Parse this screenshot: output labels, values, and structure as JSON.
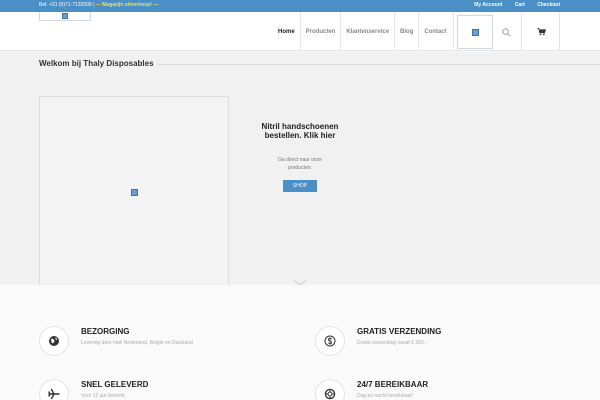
{
  "topbar": {
    "phone": "Bel: +31 (0)71-7132099",
    "promo": "| — Magazijn uitverkoop! —",
    "links": [
      "My Account",
      "Cart",
      "Checkout"
    ]
  },
  "nav": {
    "items": [
      "Home",
      "Producten",
      "Klantenservice",
      "Blog",
      "Contact"
    ],
    "active": "Home"
  },
  "hero": {
    "title": "Welkom bij Thaly Disposables",
    "promo_title": "Nitril handschoenen bestellen. Klik hier",
    "promo_sub": "Ga direct naar onze producten:",
    "shop_label": "SHOP"
  },
  "features": [
    {
      "title": "BEZORGING",
      "desc": "Levering door heel Nederland, België en Duitsland",
      "icon": "globe-icon"
    },
    {
      "title": "GRATIS VERZENDING",
      "desc": "Gratis verzending vanaf € 300,-",
      "icon": "dollar-icon"
    },
    {
      "title": "SNEL GELEVERD",
      "desc": "Voor 12 uur besteld,",
      "icon": "plane-icon"
    },
    {
      "title": "24/7 BEREIKBAAR",
      "desc": "Dag en nacht bereikbaar!",
      "icon": "support-icon"
    }
  ],
  "colors": {
    "accent": "#4b8fc7",
    "promo": "#f3e04a"
  }
}
